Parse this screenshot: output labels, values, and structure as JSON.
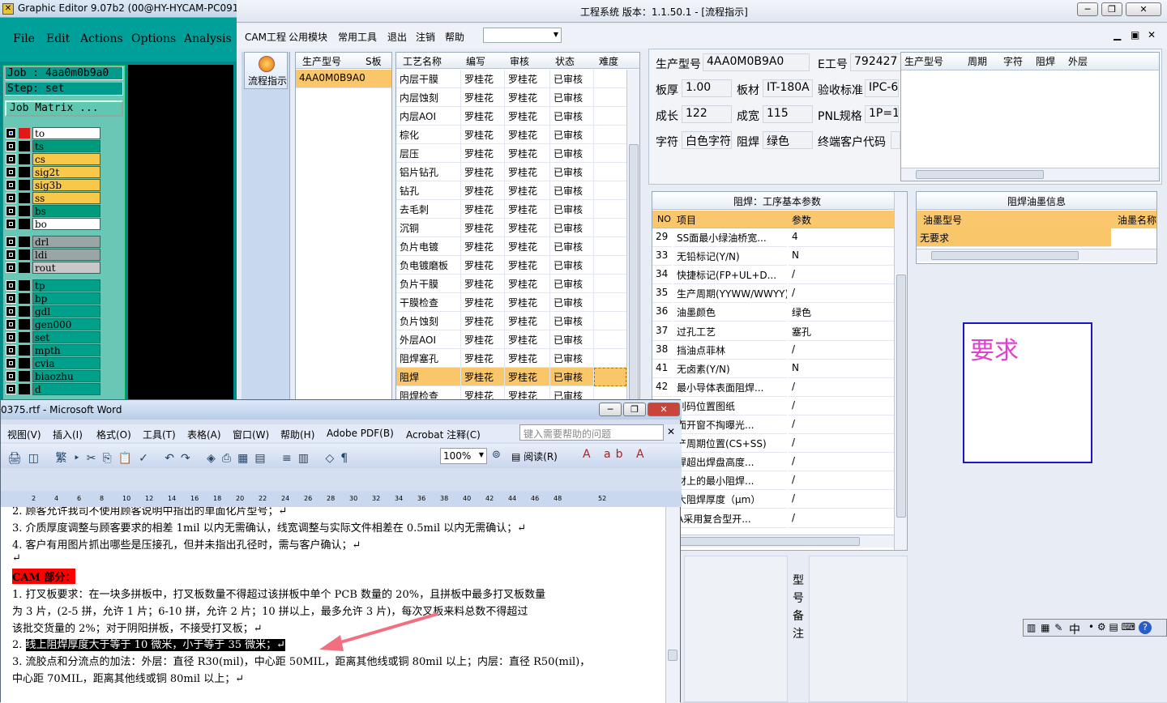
{
  "graphic_editor": {
    "title": "Graphic Editor 9.07b2 (00@HY-HYCAM-PC091",
    "menu": [
      "File",
      "Edit",
      "Actions",
      "Options",
      "Analysis"
    ],
    "job_label": "Job : 4aa0m0b9a0",
    "step_label": "Step: set",
    "job_matrix": "Job Matrix ...",
    "layers": [
      {
        "name": "to",
        "color": "#ffffff"
      },
      {
        "name": "ts",
        "color": "#009b7d"
      },
      {
        "name": "cs",
        "color": "#f7c84a"
      },
      {
        "name": "sig2t",
        "color": "#f7c84a"
      },
      {
        "name": "sig3b",
        "color": "#f7c84a"
      },
      {
        "name": "ss",
        "color": "#f7c84a"
      },
      {
        "name": "bs",
        "color": "#009b7d"
      },
      {
        "name": "bo",
        "color": "#ffffff"
      },
      {
        "name": "drl",
        "color": "#9aa6a6"
      },
      {
        "name": "ldi",
        "color": "#9aa6a6"
      },
      {
        "name": "rout",
        "color": "#c8c8c8"
      },
      {
        "name": "tp",
        "color": "#00a08a"
      },
      {
        "name": "bp",
        "color": "#00a08a"
      },
      {
        "name": "gdl",
        "color": "#00a08a"
      },
      {
        "name": "gen000",
        "color": "#00a08a"
      },
      {
        "name": "set",
        "color": "#00a08a"
      },
      {
        "name": "mpth",
        "color": "#00a08a"
      },
      {
        "name": "cvia",
        "color": "#00a08a"
      },
      {
        "name": "biaozhu",
        "color": "#00a08a"
      },
      {
        "name": "d",
        "color": "#00a08a"
      }
    ]
  },
  "cam": {
    "title": "工程系统   版本：1.1.50.1 - [流程指示]",
    "menu": [
      "CAM工程",
      "公用模块",
      "常用工具",
      "退出",
      "注销",
      "帮助"
    ],
    "side_button": "流程指示",
    "model_grid": {
      "headers": [
        "生产型号",
        "S板"
      ],
      "rows": [
        "4AA0M0B9A0"
      ]
    },
    "process_grid": {
      "headers": [
        "工艺名称",
        "编写",
        "审核",
        "状态",
        "难度"
      ],
      "rows": [
        [
          "内层干膜",
          "罗桂花",
          "罗桂花",
          "已审核"
        ],
        [
          "内层蚀刻",
          "罗桂花",
          "罗桂花",
          "已审核"
        ],
        [
          "内层AOI",
          "罗桂花",
          "罗桂花",
          "已审核"
        ],
        [
          "棕化",
          "罗桂花",
          "罗桂花",
          "已审核"
        ],
        [
          "层压",
          "罗桂花",
          "罗桂花",
          "已审核"
        ],
        [
          "铝片钻孔",
          "罗桂花",
          "罗桂花",
          "已审核"
        ],
        [
          "钻孔",
          "罗桂花",
          "罗桂花",
          "已审核"
        ],
        [
          "去毛刺",
          "罗桂花",
          "罗桂花",
          "已审核"
        ],
        [
          "沉铜",
          "罗桂花",
          "罗桂花",
          "已审核"
        ],
        [
          "负片电镀",
          "罗桂花",
          "罗桂花",
          "已审核"
        ],
        [
          "负电镀磨板",
          "罗桂花",
          "罗桂花",
          "已审核"
        ],
        [
          "负片干膜",
          "罗桂花",
          "罗桂花",
          "已审核"
        ],
        [
          "干膜检查",
          "罗桂花",
          "罗桂花",
          "已审核"
        ],
        [
          "负片蚀刻",
          "罗桂花",
          "罗桂花",
          "已审核"
        ],
        [
          "外层AOI",
          "罗桂花",
          "罗桂花",
          "已审核"
        ],
        [
          "阻焊塞孔",
          "罗桂花",
          "罗桂花",
          "已审核"
        ],
        [
          "阻焊",
          "罗桂花",
          "罗桂花",
          "已审核"
        ],
        [
          "阻焊检查",
          "罗桂花",
          "罗桂花",
          "已审核"
        ]
      ]
    },
    "info": {
      "model_label": "生产型号",
      "model_value": "4AA0M0B9A0",
      "eng_label": "E工号",
      "eng_value": "792427",
      "thick_label": "板厚",
      "thick_value": "1.00",
      "mat_label": "板材",
      "mat_value": "IT-180A",
      "std_label": "验收标准",
      "std_value": "IPC-6",
      "len_label": "成长",
      "len_value": "122",
      "wid_label": "成宽",
      "wid_value": "115",
      "pnl_label": "PNL规格",
      "pnl_value": "1P=1",
      "char_label": "字符",
      "char_value": "白色字符",
      "mask_label": "阻焊",
      "mask_value": "绿色",
      "cust_label": "终端客户代码"
    },
    "right_headers": [
      "生产型号",
      "周期",
      "字符",
      "阻焊",
      "外层"
    ],
    "params": {
      "title": "阻焊：工序基本参数",
      "headers": [
        "NO",
        "项目",
        "参数"
      ],
      "rows": [
        [
          "29",
          "SS面最小绿油桥宽...",
          "4"
        ],
        [
          "33",
          "无铅标记(Y/N)",
          "N"
        ],
        [
          "34",
          "快捷标记(FP+UL+D...",
          "/"
        ],
        [
          "35",
          "生产周期(YYWW/WWYY)",
          "/"
        ],
        [
          "36",
          "油墨颜色",
          "绿色"
        ],
        [
          "37",
          "过孔工艺",
          "塞孔"
        ],
        [
          "38",
          "挡油点菲林",
          "/"
        ],
        [
          "41",
          "无卤素(Y/N)",
          "N"
        ],
        [
          "42",
          "最小导体表面阻焊...",
          "/"
        ],
        [
          "",
          "别码位置图纸",
          "/"
        ],
        [
          "",
          "面开窗不掏曝光...",
          "/"
        ],
        [
          "",
          "产周期位置(CS+SS)",
          "/"
        ],
        [
          "",
          "焊超出焊盘高度...",
          "/"
        ],
        [
          "",
          "材上的最小阻焊...",
          "/"
        ],
        [
          "",
          "大阻焊厚度（μm）",
          "/"
        ],
        [
          "",
          "A采用复合型开...",
          "/"
        ]
      ]
    },
    "ink": {
      "title": "阻焊油墨信息",
      "headers": [
        "油墨型号",
        "油墨名称"
      ],
      "rows": [
        "无要求"
      ]
    },
    "requirement": "要求",
    "note_label": [
      "型",
      "号",
      "备",
      "注"
    ]
  },
  "word": {
    "title": "0375.rtf - Microsoft Word",
    "menu": [
      "视图(V)",
      "插入(I)",
      "格式(O)",
      "工具(T)",
      "表格(A)",
      "窗口(W)",
      "帮助(H)",
      "Adobe PDF(B)",
      "Acrobat 注释(C)"
    ],
    "help_placeholder": "键入需要帮助的问题",
    "zoom": "100%",
    "read_btn": "阅读(R)",
    "ruler": [
      "2",
      "4",
      "6",
      "8",
      "10",
      "12",
      "14",
      "16",
      "18",
      "20",
      "22",
      "24",
      "26",
      "28",
      "30",
      "32",
      "34",
      "36",
      "38",
      "40",
      "42",
      "44",
      "46",
      "48",
      "52"
    ],
    "lines": [
      "2.    顾客允许我司不使用顾客说明中指出的单面化片型号；↵",
      "3.    介质厚度调整与顾客要求的相差 1mil 以内无需确认，线宽调整与实际文件相差在 0.5mil 以内无需确认；↵",
      "4.    客户有用图片抓出哪些是压接孔，但并未指出孔径时，需与客户确认；↵",
      "↵",
      "CAM 部分：",
      "1.    打叉板要求：在一块多拼板中，打叉板数量不得超过该拼板中单个 PCB 数量的 20%，且拼板中最多打叉板数量",
      "       为 3 片，(2-5 拼，允许 1 片；6-10 拼，允许 2 片；10 拼以上，最多允许 3 片)，每次叉板来料总数不得超过",
      "       该批交货量的 2%；对于阴阳拼板，不接受打叉板；↵",
      "2.    线上阻焊厚度大于等于 10 微米，小于等于 35 微米；↵",
      "3.    流胶点和分流点的加法：外层：直径 R30(mil)，中心距 50MIL，距离其他线或铜 80mil 以上；内层：直径 R50(mil)，",
      "       中心距 70MIL，距离其他线或铜 80mil 以上；↵"
    ]
  },
  "ime": {
    "mode": "中"
  }
}
